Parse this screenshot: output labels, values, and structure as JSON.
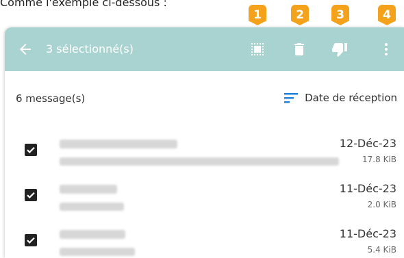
{
  "caption": "Comme l'exemple ci-dessous :",
  "badges": [
    "1",
    "2",
    "3",
    "4"
  ],
  "appbar": {
    "back_icon": "arrow-left-icon",
    "title": "3 sélectionné(s)",
    "actions": [
      {
        "name": "select-all-icon"
      },
      {
        "name": "trash-icon"
      },
      {
        "name": "thumbs-down-icon"
      },
      {
        "name": "more-vertical-icon"
      }
    ],
    "background": "#a8d3d1"
  },
  "list": {
    "count": "6 message(s)",
    "sort_label": "Date de réception",
    "sort_icon": "sort-icon",
    "accent": "#1e7fd6"
  },
  "rows": [
    {
      "date": "12-Déc-23",
      "size": "17.8 KiB",
      "checked": true
    },
    {
      "date": "11-Déc-23",
      "size": "2.0 KiB",
      "checked": true
    },
    {
      "date": "11-Déc-23",
      "size": "5.4 KiB",
      "checked": true
    }
  ],
  "badge_color": "#f4a21c"
}
